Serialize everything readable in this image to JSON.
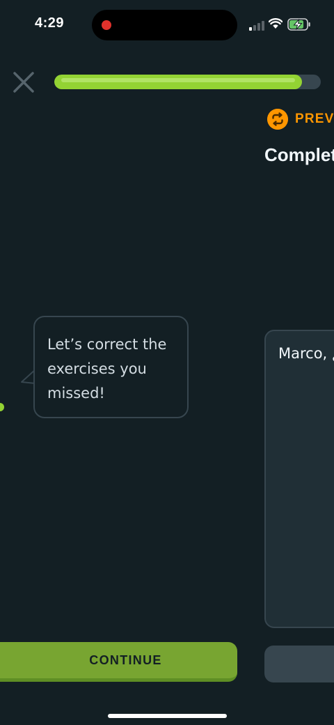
{
  "status_bar": {
    "time": "4:29",
    "recording_indicator_color": "#e0322c",
    "signal_bars_active": 1,
    "battery_charging": true
  },
  "lesson": {
    "progress_fraction": 0.93,
    "close_icon": "close-icon",
    "accent_color": "#93d333"
  },
  "review": {
    "bubble_lines": [
      "Let’s correct the",
      "exercises you",
      "missed!"
    ],
    "continue_label": "CONTINUE",
    "continue_color": "#78a531"
  },
  "next_exercise": {
    "badge_icon": "repeat-icon",
    "badge_label": "PREVI",
    "badge_color": "#ff9600",
    "title_partial": "Complet",
    "answer_partial": "Marco, ¿"
  }
}
